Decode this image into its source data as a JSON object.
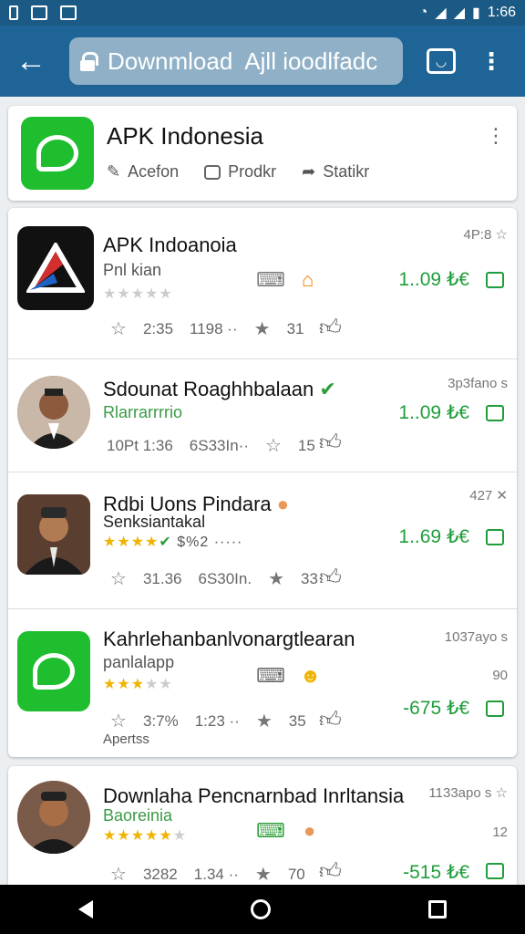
{
  "status_bar": {
    "time": "1:66"
  },
  "app_bar": {
    "url": "Downmload ⁣ Ajll ioodlfadc"
  },
  "top_card": {
    "title": "APK Indonesia",
    "actions": [
      "Acefon",
      "Prodkr",
      "Statikr"
    ]
  },
  "items": [
    {
      "title": "APK Indoanoia",
      "subtitle": "Pnl kian",
      "right_label": "4P:8 ☆",
      "price": "1..09 ₺€",
      "meta": [
        "2:35",
        "1198 ··",
        "31"
      ]
    },
    {
      "title": "Sdounat Roaghhbalaan",
      "subtitle": "Rlarrarrrrio",
      "right_label": "3p3fano s",
      "price": "1..09 ₺€",
      "meta": [
        "10Pt 1:36",
        "6S33In··",
        "15"
      ]
    },
    {
      "title": "Rdbi Uons Pindara",
      "subtitle": "Senksiantakal",
      "stars_text": "$%2 ·····",
      "right_label": "427 ✕",
      "price": "1..69 ₺€",
      "meta": [
        "31.36",
        "6S30In.",
        "33"
      ]
    },
    {
      "title": "Kahrlehanbanlvonargtlearan",
      "subtitle": "panlalapp",
      "right_label": "1037ayo s",
      "right_label2": "90",
      "price": "-675 ₺€",
      "meta": [
        "3:7%",
        "1:23 ··",
        "35"
      ],
      "footer": "Apertss"
    }
  ],
  "bottom_item": {
    "title": "Downlaha Pencnarnbad Inrltansia",
    "subtitle": "Baoreinia",
    "right_label": "1133apo s ☆",
    "right_label2": "12",
    "price": "-515 ₺€",
    "meta": [
      "3282",
      "1.34 ··",
      "70"
    ]
  }
}
